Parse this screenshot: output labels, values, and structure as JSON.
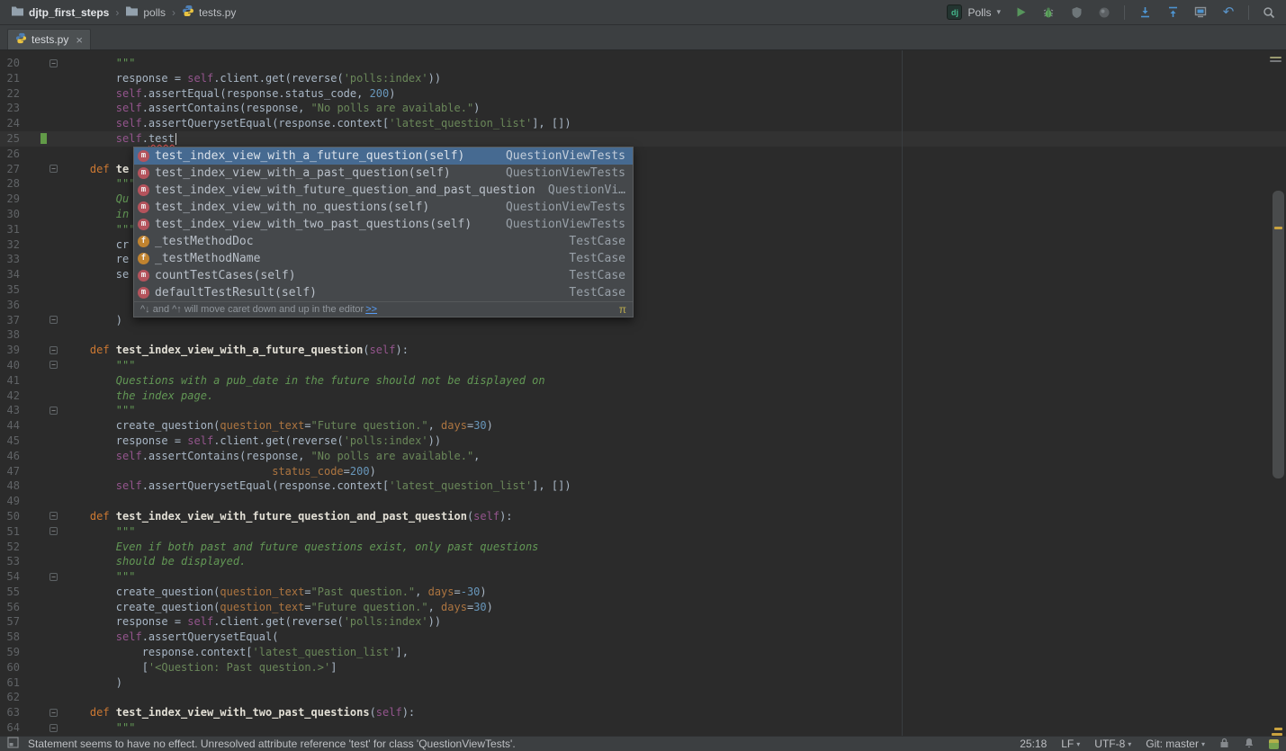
{
  "colors": {
    "editor_bg": "#2b2b2b",
    "panel_bg": "#3c3f41",
    "selection_blue": "#466a91",
    "keyword_orange": "#cc7832",
    "string_green": "#6a8759",
    "docstring_green": "#629755",
    "number_blue": "#6897bb",
    "self_purple": "#94558d",
    "run_green": "#57965c",
    "django_green": "#44b78b",
    "vcs_added_green": "#629b48",
    "error_red": "#d25252"
  },
  "glyphs": {
    "breadcrumb_separator": "›",
    "dropdown_arrow": "▾",
    "tab_close": "×",
    "rollback": "↶",
    "fold_minus": "−"
  },
  "breadcrumb": {
    "items": [
      {
        "label": "djtp_first_steps",
        "icon": "folder"
      },
      {
        "label": "polls",
        "icon": "folder"
      },
      {
        "label": "tests.py",
        "icon": "python-file"
      }
    ]
  },
  "toolbar": {
    "django_badge": "dj",
    "run_config": "Polls"
  },
  "tab": {
    "title": "tests.py"
  },
  "editor": {
    "lines": [
      {
        "n": 20,
        "marks": [
          "fold"
        ],
        "tokens": [
          [
            "d",
            "        \"\"\""
          ]
        ]
      },
      {
        "n": 21,
        "tokens": [
          [
            "t",
            "        response = "
          ],
          [
            "p",
            "self"
          ],
          [
            "t",
            ".client.get(reverse("
          ],
          [
            "s",
            "'polls:index'"
          ],
          [
            "t",
            "))"
          ]
        ]
      },
      {
        "n": 22,
        "tokens": [
          [
            "t",
            "        "
          ],
          [
            "p",
            "self"
          ],
          [
            "t",
            ".assertEqual(response.status_code, "
          ],
          [
            "n",
            "200"
          ],
          [
            "t",
            ")"
          ]
        ]
      },
      {
        "n": 23,
        "tokens": [
          [
            "t",
            "        "
          ],
          [
            "p",
            "self"
          ],
          [
            "t",
            ".assertContains(response, "
          ],
          [
            "s",
            "\"No polls are available.\""
          ],
          [
            "t",
            ")"
          ]
        ]
      },
      {
        "n": 24,
        "tokens": [
          [
            "t",
            "        "
          ],
          [
            "p",
            "self"
          ],
          [
            "t",
            ".assertQuerysetEqual(response.context["
          ],
          [
            "s",
            "'latest_question_list'"
          ],
          [
            "t",
            "], [])"
          ]
        ]
      },
      {
        "n": 25,
        "current": true,
        "caret": true,
        "marks": [
          "vcs"
        ],
        "tokens": [
          [
            "t",
            "        "
          ],
          [
            "p",
            "self"
          ],
          [
            "t",
            "."
          ],
          [
            "e",
            "test"
          ]
        ]
      },
      {
        "n": 26,
        "tokens": []
      },
      {
        "n": 27,
        "marks": [
          "fold"
        ],
        "tokens": [
          [
            "k",
            "    def "
          ],
          [
            "f",
            "te"
          ]
        ]
      },
      {
        "n": 28,
        "tokens": [
          [
            "d",
            "        \"\"\""
          ]
        ]
      },
      {
        "n": 29,
        "tokens": [
          [
            "d",
            "        Qu"
          ]
        ]
      },
      {
        "n": 30,
        "tokens": [
          [
            "d",
            "        in"
          ]
        ]
      },
      {
        "n": 31,
        "tokens": [
          [
            "d",
            "        \"\"\""
          ]
        ]
      },
      {
        "n": 32,
        "tokens": [
          [
            "t",
            "        cr"
          ]
        ]
      },
      {
        "n": 33,
        "tokens": [
          [
            "t",
            "        re"
          ]
        ]
      },
      {
        "n": 34,
        "tokens": [
          [
            "t",
            "        se"
          ]
        ]
      },
      {
        "n": 35,
        "tokens": []
      },
      {
        "n": 36,
        "tokens": []
      },
      {
        "n": 37,
        "marks": [
          "fold"
        ],
        "tokens": [
          [
            "t",
            "        )"
          ]
        ]
      },
      {
        "n": 38,
        "tokens": []
      },
      {
        "n": 39,
        "marks": [
          "fold"
        ],
        "tokens": [
          [
            "k",
            "    def "
          ],
          [
            "f",
            "test_index_view_with_a_future_question"
          ],
          [
            "t",
            "("
          ],
          [
            "p",
            "self"
          ],
          [
            "t",
            "):"
          ]
        ]
      },
      {
        "n": 40,
        "marks": [
          "fold"
        ],
        "tokens": [
          [
            "d",
            "        \"\"\""
          ]
        ]
      },
      {
        "n": 41,
        "tokens": [
          [
            "d",
            "        Questions with a pub_date in the future should not be displayed on"
          ]
        ]
      },
      {
        "n": 42,
        "tokens": [
          [
            "d",
            "        the index page."
          ]
        ]
      },
      {
        "n": 43,
        "marks": [
          "fold"
        ],
        "tokens": [
          [
            "d",
            "        \"\"\""
          ]
        ]
      },
      {
        "n": 44,
        "tokens": [
          [
            "t",
            "        create_question("
          ],
          [
            "a",
            "question_text"
          ],
          [
            "t",
            "="
          ],
          [
            "s",
            "\"Future question.\""
          ],
          [
            "t",
            ", "
          ],
          [
            "a",
            "days"
          ],
          [
            "t",
            "="
          ],
          [
            "n",
            "30"
          ],
          [
            "t",
            ")"
          ]
        ]
      },
      {
        "n": 45,
        "tokens": [
          [
            "t",
            "        response = "
          ],
          [
            "p",
            "self"
          ],
          [
            "t",
            ".client.get(reverse("
          ],
          [
            "s",
            "'polls:index'"
          ],
          [
            "t",
            "))"
          ]
        ]
      },
      {
        "n": 46,
        "tokens": [
          [
            "t",
            "        "
          ],
          [
            "p",
            "self"
          ],
          [
            "t",
            ".assertContains(response, "
          ],
          [
            "s",
            "\"No polls are available.\""
          ],
          [
            "t",
            ","
          ]
        ]
      },
      {
        "n": 47,
        "tokens": [
          [
            "t",
            "                                "
          ],
          [
            "a",
            "status_code"
          ],
          [
            "t",
            "="
          ],
          [
            "n",
            "200"
          ],
          [
            "t",
            ")"
          ]
        ]
      },
      {
        "n": 48,
        "tokens": [
          [
            "t",
            "        "
          ],
          [
            "p",
            "self"
          ],
          [
            "t",
            ".assertQuerysetEqual(response.context["
          ],
          [
            "s",
            "'latest_question_list'"
          ],
          [
            "t",
            "], [])"
          ]
        ]
      },
      {
        "n": 49,
        "tokens": []
      },
      {
        "n": 50,
        "marks": [
          "fold"
        ],
        "tokens": [
          [
            "k",
            "    def "
          ],
          [
            "f",
            "test_index_view_with_future_question_and_past_question"
          ],
          [
            "t",
            "("
          ],
          [
            "p",
            "self"
          ],
          [
            "t",
            "):"
          ]
        ]
      },
      {
        "n": 51,
        "marks": [
          "fold"
        ],
        "tokens": [
          [
            "d",
            "        \"\"\""
          ]
        ]
      },
      {
        "n": 52,
        "tokens": [
          [
            "d",
            "        Even if both past and future questions exist, only past questions"
          ]
        ]
      },
      {
        "n": 53,
        "tokens": [
          [
            "d",
            "        should be displayed."
          ]
        ]
      },
      {
        "n": 54,
        "marks": [
          "fold"
        ],
        "tokens": [
          [
            "d",
            "        \"\"\""
          ]
        ]
      },
      {
        "n": 55,
        "tokens": [
          [
            "t",
            "        create_question("
          ],
          [
            "a",
            "question_text"
          ],
          [
            "t",
            "="
          ],
          [
            "s",
            "\"Past question.\""
          ],
          [
            "t",
            ", "
          ],
          [
            "a",
            "days"
          ],
          [
            "t",
            "="
          ],
          [
            "n",
            "-30"
          ],
          [
            "t",
            ")"
          ]
        ]
      },
      {
        "n": 56,
        "tokens": [
          [
            "t",
            "        create_question("
          ],
          [
            "a",
            "question_text"
          ],
          [
            "t",
            "="
          ],
          [
            "s",
            "\"Future question.\""
          ],
          [
            "t",
            ", "
          ],
          [
            "a",
            "days"
          ],
          [
            "t",
            "="
          ],
          [
            "n",
            "30"
          ],
          [
            "t",
            ")"
          ]
        ]
      },
      {
        "n": 57,
        "tokens": [
          [
            "t",
            "        response = "
          ],
          [
            "p",
            "self"
          ],
          [
            "t",
            ".client.get(reverse("
          ],
          [
            "s",
            "'polls:index'"
          ],
          [
            "t",
            "))"
          ]
        ]
      },
      {
        "n": 58,
        "tokens": [
          [
            "t",
            "        "
          ],
          [
            "p",
            "self"
          ],
          [
            "t",
            ".assertQuerysetEqual("
          ]
        ]
      },
      {
        "n": 59,
        "tokens": [
          [
            "t",
            "            response.context["
          ],
          [
            "s",
            "'latest_question_list'"
          ],
          [
            "t",
            "],"
          ]
        ]
      },
      {
        "n": 60,
        "tokens": [
          [
            "t",
            "            ["
          ],
          [
            "s",
            "'<Question: Past question.>'"
          ],
          [
            "t",
            "]"
          ]
        ]
      },
      {
        "n": 61,
        "tokens": [
          [
            "t",
            "        )"
          ]
        ]
      },
      {
        "n": 62,
        "tokens": []
      },
      {
        "n": 63,
        "marks": [
          "fold"
        ],
        "tokens": [
          [
            "k",
            "    def "
          ],
          [
            "f",
            "test_index_view_with_two_past_questions"
          ],
          [
            "t",
            "("
          ],
          [
            "p",
            "self"
          ],
          [
            "t",
            "):"
          ]
        ]
      },
      {
        "n": 64,
        "marks": [
          "fold"
        ],
        "tokens": [
          [
            "d",
            "        \"\"\""
          ]
        ]
      }
    ]
  },
  "popup": {
    "selected_index": 0,
    "items": [
      {
        "icon": "method",
        "glyph": "m",
        "label": "test_index_view_with_a_future_question(self)",
        "type": "QuestionViewTests"
      },
      {
        "icon": "method",
        "glyph": "m",
        "label": "test_index_view_with_a_past_question(self)",
        "type": "QuestionViewTests"
      },
      {
        "icon": "method",
        "glyph": "m",
        "label": "test_index_view_with_future_question_and_past_question",
        "type": "QuestionVi…"
      },
      {
        "icon": "method",
        "glyph": "m",
        "label": "test_index_view_with_no_questions(self)",
        "type": "QuestionViewTests"
      },
      {
        "icon": "method",
        "glyph": "m",
        "label": "test_index_view_with_two_past_questions(self)",
        "type": "QuestionViewTests"
      },
      {
        "icon": "field",
        "glyph": "f",
        "label": "_testMethodDoc",
        "type": "TestCase"
      },
      {
        "icon": "field",
        "glyph": "f",
        "label": "_testMethodName",
        "type": "TestCase"
      },
      {
        "icon": "method",
        "glyph": "m",
        "label": "countTestCases(self)",
        "type": "TestCase"
      },
      {
        "icon": "method",
        "glyph": "m",
        "label": "defaultTestResult(self)",
        "type": "TestCase"
      }
    ],
    "footer": {
      "text": "^↓ and ^↑ will move caret down and up in the editor ",
      "link": ">>",
      "symbol": "π"
    }
  },
  "status_bar": {
    "message": "Statement seems to have no effect. Unresolved attribute reference 'test' for class 'QuestionViewTests'.",
    "caret_position": "25:18",
    "line_separator": "LF",
    "encoding": "UTF-8",
    "vcs_branch": "Git: master"
  }
}
